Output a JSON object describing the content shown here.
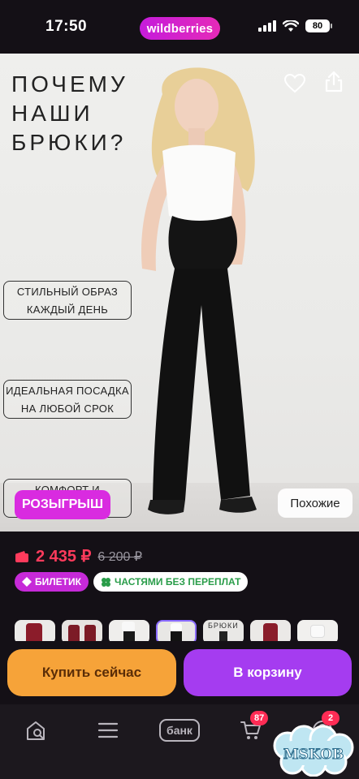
{
  "status_bar": {
    "time": "17:50",
    "brand": "wildberries",
    "battery": "80"
  },
  "hero": {
    "title": "ПОЧЕМУ\nНАШИ\nБРЮКИ?",
    "features": [
      "СТИЛЬНЫЙ ОБРАЗ\nКАЖДЫЙ ДЕНЬ",
      "ИДЕАЛЬНАЯ ПОСАДКА\nНА ЛЮБОЙ СРОК",
      "КОМФОРТ И МЯГКОСТЬ"
    ],
    "raffle_label": "РОЗЫГРЫШ",
    "similar_label": "Похожие"
  },
  "price": {
    "current": "2 435 ₽",
    "old": "6 200 ₽",
    "current_color": "#ff3b5c"
  },
  "badges": {
    "ticket": "БИЛЕТИК",
    "installments": "ЧАСТЯМИ БЕЗ ПЕРЕПЛАТ"
  },
  "thumbnails": {
    "collage_label": "БРЮКИ"
  },
  "actions": {
    "buy_now": "Купить сейчас",
    "add_to_cart": "В корзину"
  },
  "nav": {
    "bank_label": "банк",
    "cart_count": "87",
    "profile_count": "2",
    "icons": [
      "home-search-icon",
      "catalog-menu-icon",
      "bank-icon",
      "cart-icon",
      "profile-icon"
    ]
  },
  "watermark": "MSKOB",
  "colors": {
    "brand": "#c51cdb",
    "buy": "#f6a339",
    "cart": "#a53cf0"
  }
}
